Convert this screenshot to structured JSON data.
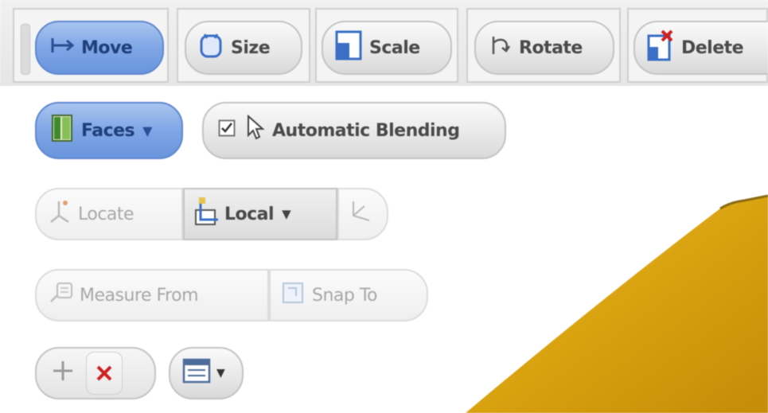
{
  "toolbar": {
    "move_label": "Move",
    "size_label": "Size",
    "scale_label": "Scale",
    "rotate_label": "Rotate",
    "delete_label": "Delete"
  },
  "faces_dropdown": {
    "label": "Faces",
    "selected": true
  },
  "automatic_blending": {
    "label": "Automatic Blending",
    "checked": true
  },
  "locate": {
    "label": "Locate"
  },
  "coordinate_dropdown": {
    "label": "Local"
  },
  "measure_from": {
    "label": "Measure From"
  },
  "snap_to": {
    "label": "Snap To"
  },
  "icons": {
    "move": "move-arrow-icon",
    "size": "size-icon",
    "scale": "scale-icon",
    "rotate": "rotate-icon",
    "delete": "delete-icon",
    "faces": "faces-icon",
    "locate": "locate-icon",
    "local": "local-axis-icon",
    "measure": "measure-icon",
    "snap": "snap-icon",
    "add": "plus-icon",
    "remove": "red-x-icon",
    "layout": "layout-icon"
  },
  "colors": {
    "active_blue": "#7fa6e6",
    "yellow_shape": "#d9a20f",
    "delete_red": "#d02020"
  }
}
